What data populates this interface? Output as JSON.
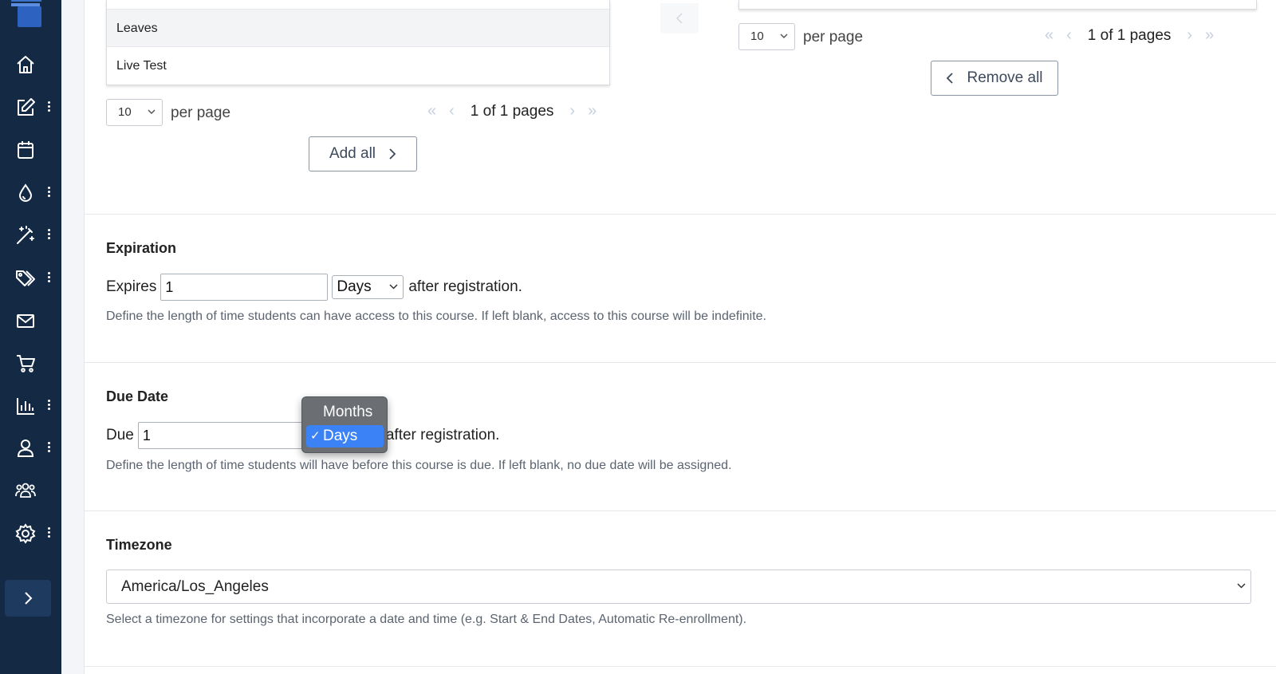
{
  "sidebar": {
    "items": [
      {
        "name": "home",
        "icon": "home-icon",
        "has_menu": false
      },
      {
        "name": "edit",
        "icon": "edit-icon",
        "has_menu": true
      },
      {
        "name": "calendar",
        "icon": "calendar-icon",
        "has_menu": false
      },
      {
        "name": "drop",
        "icon": "drop-icon",
        "has_menu": true
      },
      {
        "name": "magic-wand",
        "icon": "magic-wand-icon",
        "has_menu": true
      },
      {
        "name": "tags",
        "icon": "tags-icon",
        "has_menu": true
      },
      {
        "name": "mail",
        "icon": "mail-icon",
        "has_menu": false
      },
      {
        "name": "cart",
        "icon": "cart-icon",
        "has_menu": false
      },
      {
        "name": "reports",
        "icon": "bar-chart-icon",
        "has_menu": true
      },
      {
        "name": "user",
        "icon": "user-icon",
        "has_menu": true
      },
      {
        "name": "groups",
        "icon": "users-icon",
        "has_menu": false
      },
      {
        "name": "settings",
        "icon": "gear-icon",
        "has_menu": true
      }
    ]
  },
  "available_list": {
    "rows": [
      "Leaves",
      "Live Test"
    ],
    "per_page_value": "10",
    "per_page_label": "per page",
    "pager_text": "1 of 1 pages",
    "add_all_label": "Add all"
  },
  "selected_list": {
    "per_page_value": "10",
    "per_page_label": "per page",
    "pager_text": "1 of 1 pages",
    "remove_all_label": "Remove all"
  },
  "expiration": {
    "title": "Expiration",
    "prefix": "Expires",
    "value": "1",
    "unit": "Days",
    "suffix": "after registration.",
    "help": "Define the length of time students can have access to this course. If left blank, access to this course will be indefinite."
  },
  "due_date": {
    "title": "Due Date",
    "prefix": "Due",
    "value": "1",
    "suffix": "after registration.",
    "help": "Define the length of time students will have before this course is due. If left blank, no due date will be assigned.",
    "dropdown_options": [
      "Months",
      "Days"
    ],
    "selected_option": "Days",
    "check_mark": "✓"
  },
  "timezone": {
    "title": "Timezone",
    "value": "America/Los_Angeles",
    "help": "Select a timezone for settings that incorporate a date and time (e.g. Start & End Dates, Automatic Re-enrollment)."
  },
  "colors": {
    "sidebar_bg": "#142944",
    "selection_blue": "#3b82f6",
    "popup_bg": "#6b6f73"
  }
}
